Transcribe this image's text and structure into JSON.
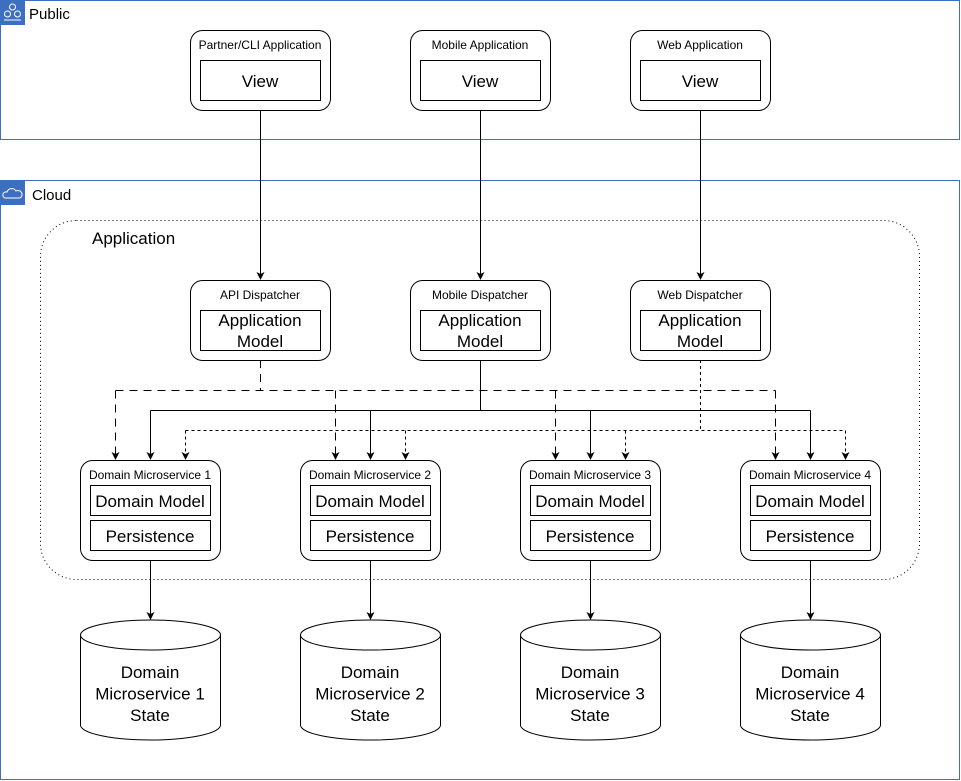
{
  "groups": {
    "public": {
      "label": "Public",
      "icon": "users-group-icon",
      "color": "#3d6fc1"
    },
    "cloud": {
      "label": "Cloud",
      "icon": "cloud-icon",
      "color": "#3d6fc1"
    },
    "application": {
      "label": "Application"
    }
  },
  "clients": [
    {
      "title": "Partner/CLI Application",
      "inner": "View"
    },
    {
      "title": "Mobile Application",
      "inner": "View"
    },
    {
      "title": "Web Application",
      "inner": "View"
    }
  ],
  "dispatchers": [
    {
      "title": "API Dispatcher",
      "inner1": "Application",
      "inner2": "Model",
      "edge_style": "dashed"
    },
    {
      "title": "Mobile Dispatcher",
      "inner1": "Application",
      "inner2": "Model",
      "edge_style": "solid"
    },
    {
      "title": "Web Dispatcher",
      "inner1": "Application",
      "inner2": "Model",
      "edge_style": "dotted"
    }
  ],
  "services": [
    {
      "title": "Domain Microservice 1",
      "model": "Domain Model",
      "persistence": "Persistence",
      "state": [
        "Domain",
        "Microservice 1",
        "State"
      ]
    },
    {
      "title": "Domain Microservice 2",
      "model": "Domain Model",
      "persistence": "Persistence",
      "state": [
        "Domain",
        "Microservice 2",
        "State"
      ]
    },
    {
      "title": "Domain Microservice 3",
      "model": "Domain Model",
      "persistence": "Persistence",
      "state": [
        "Domain",
        "Microservice 3",
        "State"
      ]
    },
    {
      "title": "Domain Microservice 4",
      "model": "Domain Model",
      "persistence": "Persistence",
      "state": [
        "Domain",
        "Microservice 4",
        "State"
      ]
    }
  ]
}
